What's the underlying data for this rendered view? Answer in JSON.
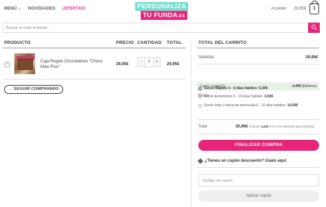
{
  "header": {
    "menu_label": "MENÚ",
    "novedades_label": "NOVEDADES",
    "ofertas_label": "¡OFERTAS!",
    "logo_line1": "PERSONALIZA",
    "logo_line2": "TU FUNDA",
    "logo_suffix": ".ES",
    "account_label": "Acceder",
    "cart_price": "29,95€",
    "cart_count": "1"
  },
  "search": {
    "placeholder": "Buscar en toda la tienda..."
  },
  "table": {
    "col_product": "PRODUCTO",
    "col_price": "PRECIO",
    "col_qty": "CANTIDAD",
    "col_total": "TOTAL"
  },
  "item": {
    "name": "Caja Regalo Chocolatinas \"Choco Maxi Plus\"",
    "price": "29,95€",
    "quantity": "1",
    "total": "29,95€",
    "remove": "×",
    "minus": "-",
    "plus": "+"
  },
  "continue_label": "← SEGUIR COMPRANDO",
  "cart_totals": {
    "title": "TOTAL DEL CARRITO",
    "subtotal_label": "Subtotal",
    "subtotal_value": "29,95€",
    "coupon_label": "Cupón: regalo15",
    "coupon_amount": "-4,49€",
    "coupon_remove": "[Eliminar]",
    "shipping_label": "Envío",
    "shipping_options": [
      {
        "label": "Envío Rápido 3 - 6 días hábiles:",
        "price": "5,50€",
        "selected": true
      },
      {
        "label": "Envío Económico 6 - 10 días hábiles:",
        "price": "3,50€",
        "selected": false
      },
      {
        "label": "Envío Islas y fuera de península 6 - 10 días hábiles:",
        "price": "14,95€",
        "selected": false
      }
    ],
    "total_label": "Total",
    "total_value": "30,96€",
    "total_note_pre": "(incluye",
    "total_tax": "4,42€",
    "total_note_post": "IVA 21% estimado para España)",
    "checkout_label": "FINALIZAR COMPRA",
    "coupon_question": "¿Tienes un cupón descuento? Úsalo aquí:",
    "coupon_placeholder": "Código de cupón",
    "apply_label": "Aplicar cupón"
  },
  "colors": {
    "accent": "#e8257a",
    "teal": "#6fe0d0"
  }
}
